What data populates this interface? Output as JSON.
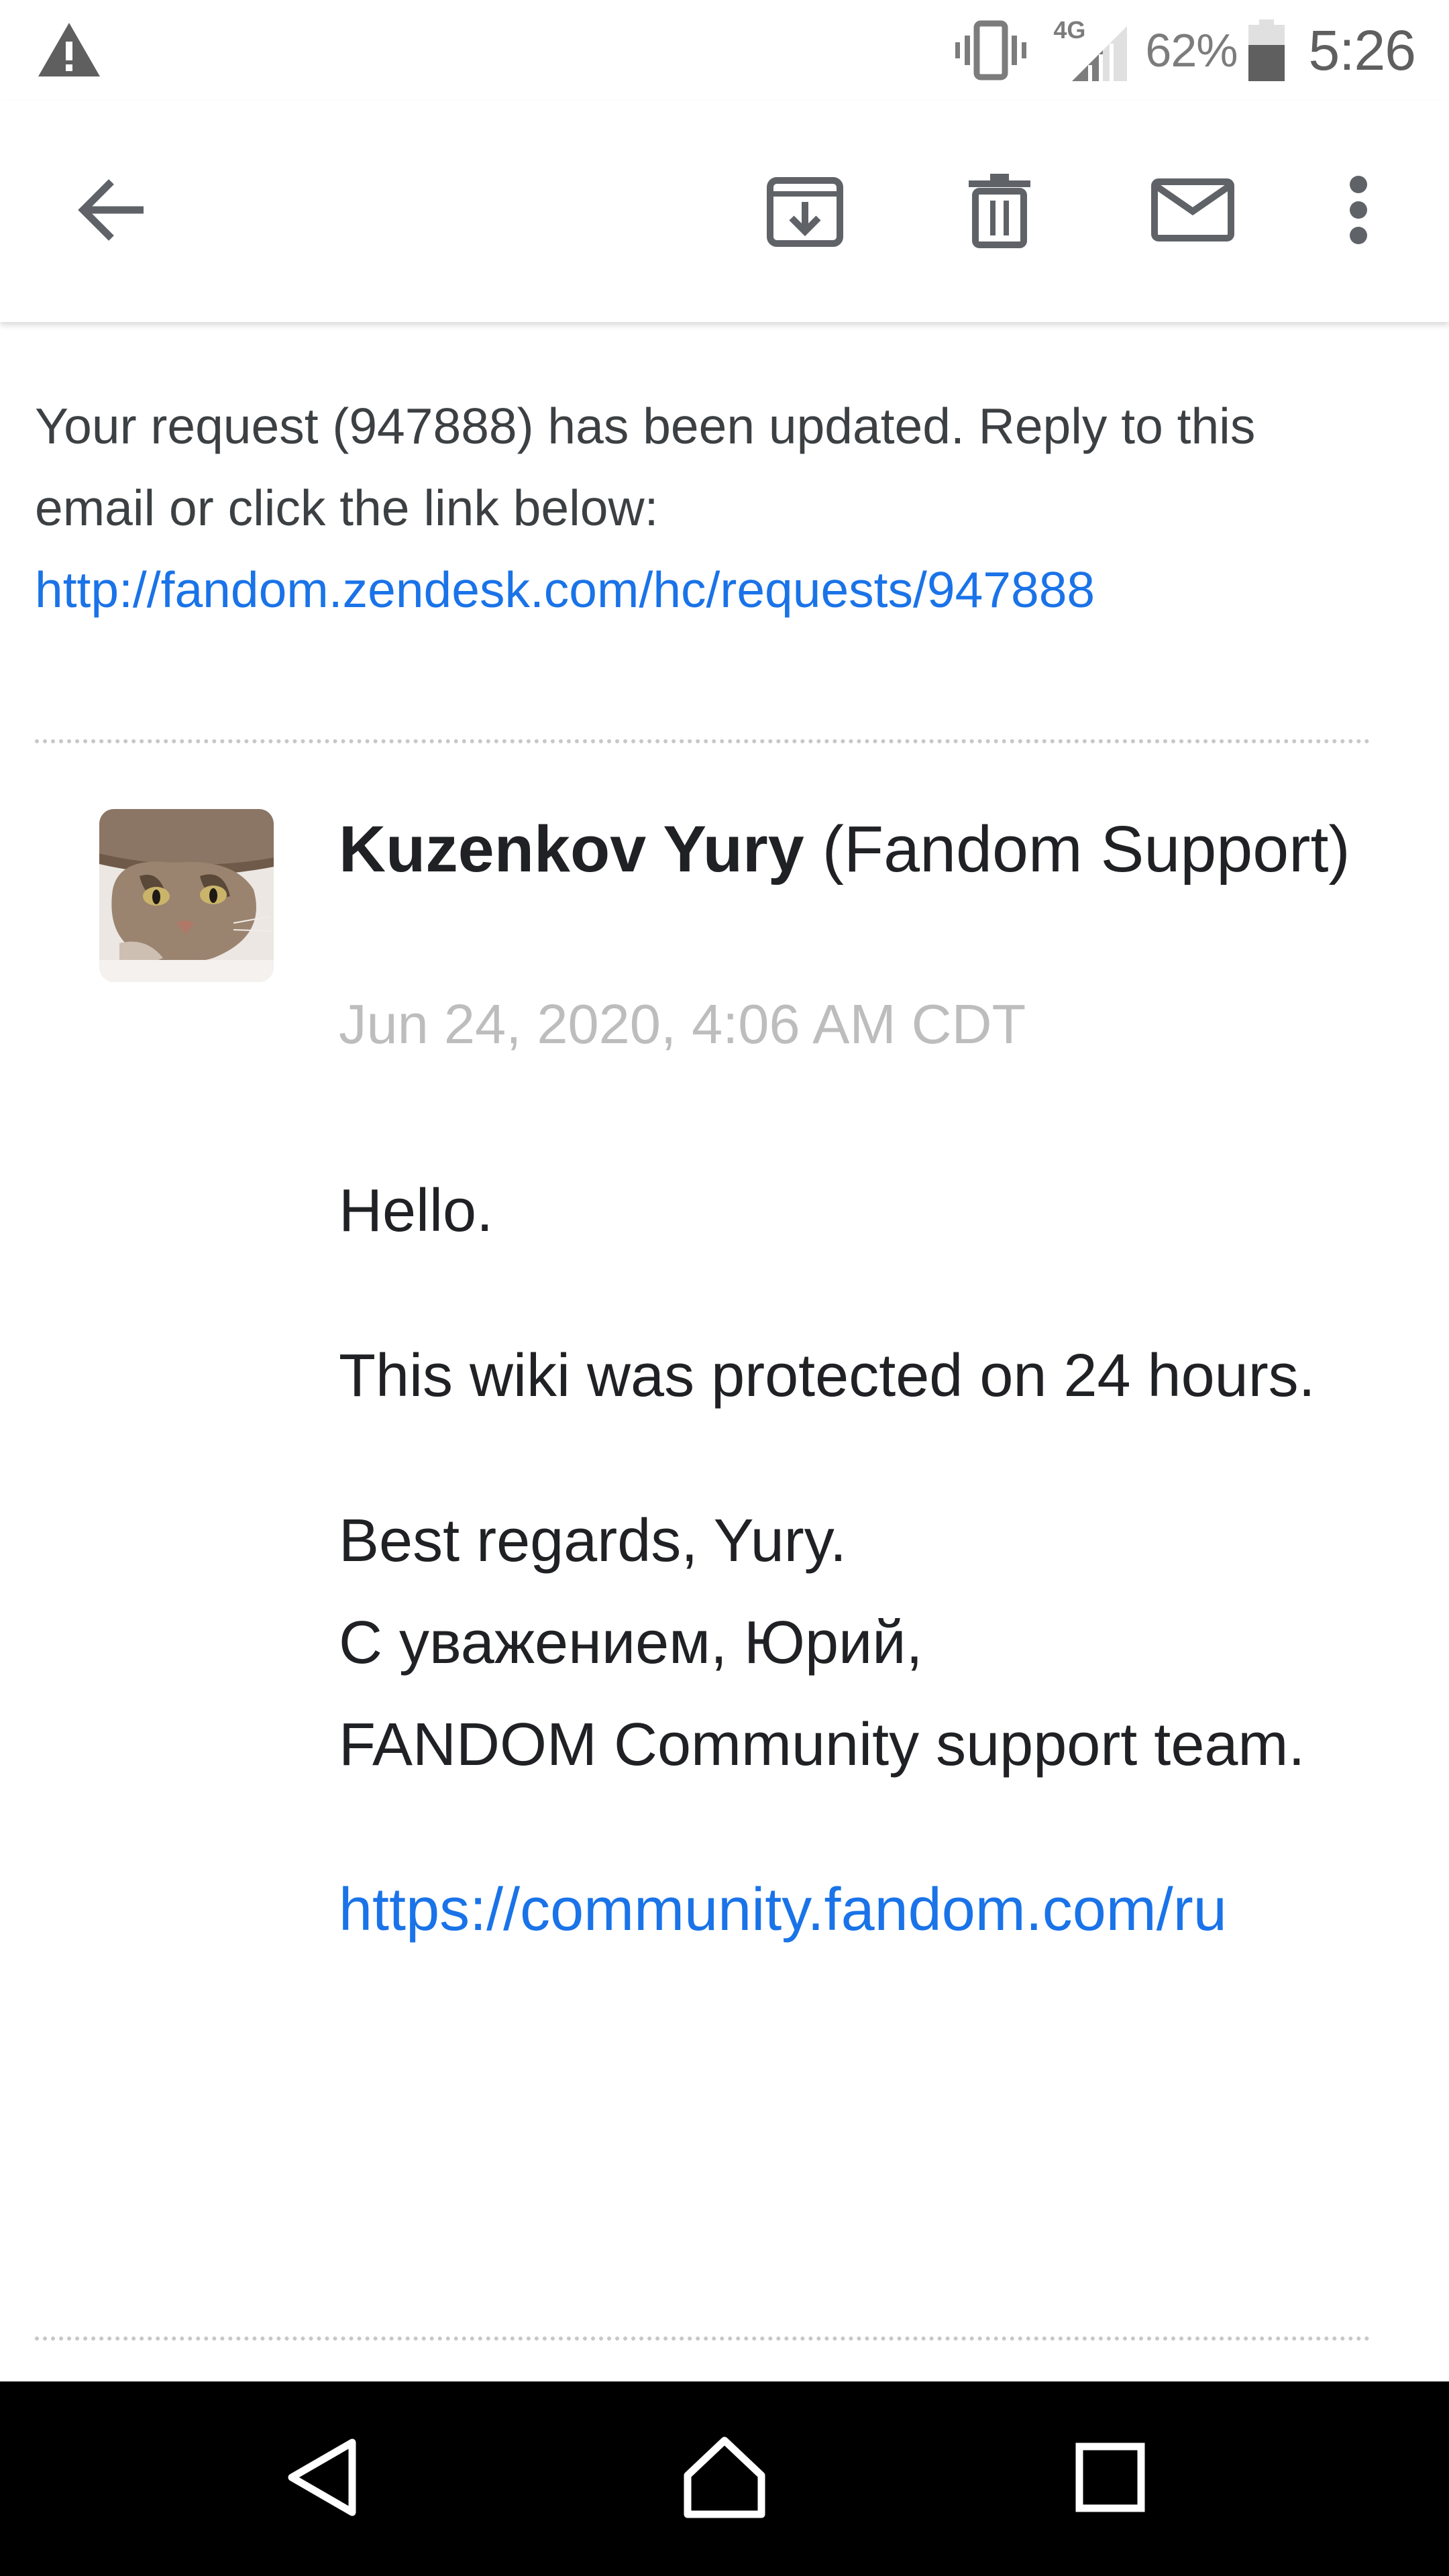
{
  "status_bar": {
    "alert_icon": "warning-triangle-icon",
    "vibrate_icon": "vibrate-icon",
    "network_type": "4G",
    "signal_icon": "cell-signal-icon",
    "battery_percent": "62%",
    "battery_icon": "battery-icon",
    "time": "5:26"
  },
  "app_bar": {
    "back_icon": "arrow-back-icon",
    "archive_icon": "archive-icon",
    "delete_icon": "trash-icon",
    "mark_unread_icon": "mail-icon",
    "more_icon": "more-vert-icon"
  },
  "email": {
    "intro_text": "Your request (947888) has been updated. Reply to this email or click the link below:",
    "request_link": "http://fandom.zendesk.com/hc/requests/947888",
    "comment": {
      "author_name": "Kuzenkov Yury",
      "author_org": "(Fandom Support)",
      "date": "Jun 24, 2020, 4:06 AM CDT",
      "greeting": "Hello.",
      "message": "This wiki was protected on 24 hours.",
      "signature": [
        "Best regards, Yury.",
        "С уважением, Юрий,",
        "FANDOM Community support team."
      ],
      "community_link": "https://community.fandom.com/ru"
    }
  },
  "nav_bar": {
    "back_icon": "nav-back-triangle-icon",
    "home_icon": "nav-home-icon",
    "recents_icon": "nav-recents-square-icon"
  },
  "colors": {
    "link": "#1a73e8",
    "text_primary": "#202124",
    "text_secondary": "#3c4043",
    "date_gray": "#bdbdbd",
    "icon_gray": "#5f6368",
    "nav_background": "#000000"
  }
}
